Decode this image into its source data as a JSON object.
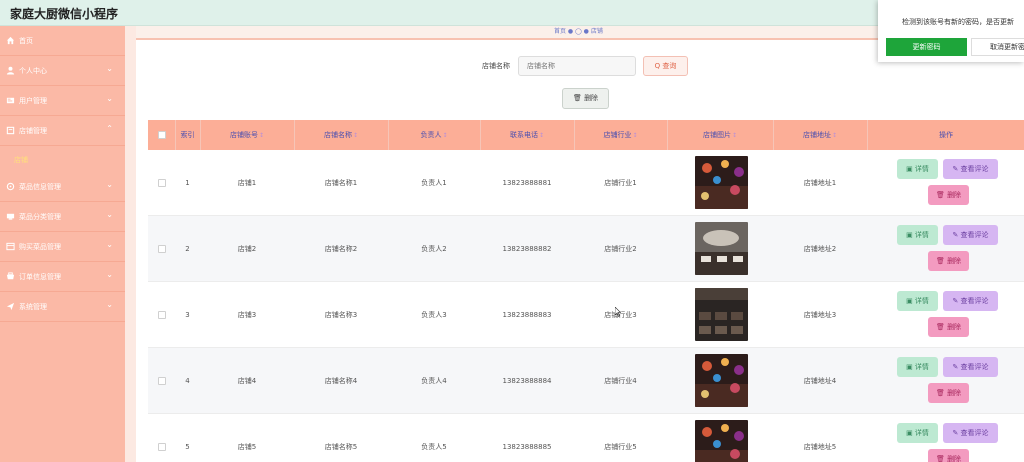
{
  "app": {
    "title": "家庭大厨微信小程序"
  },
  "breadcrumb": {
    "text": "首页 ● ◯ ● 店铺"
  },
  "sidebar": {
    "items": [
      {
        "label": "首页",
        "icon": "home-icon",
        "chevron": ""
      },
      {
        "label": "个人中心",
        "icon": "user-icon",
        "chevron": "⌄"
      },
      {
        "label": "用户管理",
        "icon": "users-icon",
        "chevron": "⌄"
      },
      {
        "label": "店铺管理",
        "icon": "store-icon",
        "chevron": "⌃"
      },
      {
        "label": "菜品信息管理",
        "icon": "dish-icon",
        "chevron": "⌄"
      },
      {
        "label": "菜品分类管理",
        "icon": "category-icon",
        "chevron": "⌄"
      },
      {
        "label": "购买菜品管理",
        "icon": "cart-icon",
        "chevron": "⌄"
      },
      {
        "label": "订单信息管理",
        "icon": "order-icon",
        "chevron": "⌄"
      },
      {
        "label": "系统管理",
        "icon": "send-icon",
        "chevron": "⌄"
      }
    ],
    "sub_item": "店铺"
  },
  "search": {
    "label": "店铺名称",
    "placeholder": "店铺名称",
    "button": "Q 查询"
  },
  "toolbar": {
    "delete_label": "删除"
  },
  "table": {
    "headers": {
      "index": "索引",
      "account": "店铺账号",
      "name": "店铺名称",
      "manager": "负责人",
      "phone": "联系电话",
      "industry": "店铺行业",
      "image": "店铺图片",
      "address": "店铺地址",
      "actions": "操作"
    },
    "sort_mark": "↕",
    "rows": [
      {
        "index": "1",
        "account": "店铺1",
        "name": "店铺名称1",
        "manager": "负责人1",
        "phone": "13823888881",
        "industry": "店铺行业1",
        "address": "店铺地址1"
      },
      {
        "index": "2",
        "account": "店铺2",
        "name": "店铺名称2",
        "manager": "负责人2",
        "phone": "13823888882",
        "industry": "店铺行业2",
        "address": "店铺地址2"
      },
      {
        "index": "3",
        "account": "店铺3",
        "name": "店铺名称3",
        "manager": "负责人3",
        "phone": "13823888883",
        "industry": "店铺行业3",
        "address": "店铺地址3"
      },
      {
        "index": "4",
        "account": "店铺4",
        "name": "店铺名称4",
        "manager": "负责人4",
        "phone": "13823888884",
        "industry": "店铺行业4",
        "address": "店铺地址4"
      },
      {
        "index": "5",
        "account": "店铺5",
        "name": "店铺名称5",
        "manager": "负责人5",
        "phone": "13823888885",
        "industry": "店铺行业5",
        "address": "店铺地址5"
      }
    ],
    "actions": {
      "detail": "详情",
      "review": "查看评论",
      "delete": "删除"
    }
  },
  "popup": {
    "message": "检测到该账号有新的密码，是否更新",
    "confirm": "更新密码",
    "cancel": "取消更新密码"
  },
  "colors": {
    "sidebar": "#fbb9a6",
    "table_header": "#fcae97",
    "header_bar": "#dff1ea",
    "btn_detail": "#bde9d2",
    "btn_review": "#d6b6f2",
    "btn_delete": "#f39bc0",
    "popup_confirm": "#1ea53a"
  }
}
